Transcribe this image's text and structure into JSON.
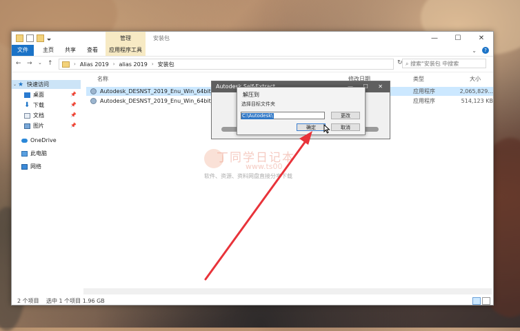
{
  "explorer": {
    "manage_tab": "管理",
    "title": "安装包",
    "window_controls": [
      "—",
      "☐",
      "✕"
    ],
    "ribbon_tabs": {
      "file": "文件",
      "home": "主页",
      "share": "共享",
      "view": "查看",
      "app_tools": "应用程序工具"
    },
    "help_icon": "?",
    "nav_icons": {
      "back": "←",
      "forward": "→",
      "dropdown": "⌄",
      "up": "↑",
      "refresh": "↻"
    },
    "breadcrumb": [
      "Alias 2019",
      "alias 2019",
      "安装包"
    ],
    "search_placeholder": "搜索\"安装包 中搜索",
    "sidebar": {
      "quick_access": "快速访问",
      "desktop": "桌面",
      "downloads": "下载",
      "documents": "文档",
      "pictures": "图片",
      "onedrive": "OneDrive",
      "this_pc": "此电脑",
      "network": "网络"
    },
    "columns": {
      "name": "名称",
      "date": "修改日期",
      "type": "类型",
      "size": "大小"
    },
    "files": [
      {
        "name": "Autodesk_DESNST_2019_Enu_Win_64bit_dlm_00",
        "type": "应用程序",
        "size": "2,065,829..."
      },
      {
        "name": "Autodesk_DESNST_2019_Enu_Win_64bit_dlm_00",
        "type": "应用程序",
        "size": "514,123 KB"
      }
    ],
    "status": {
      "count": "2 个项目",
      "selected": "选中 1 个项目  1.96 GB"
    }
  },
  "self_extract": {
    "title": "Autodesk Self-Extract",
    "controls": "— ☐ ✕"
  },
  "unzip_dialog": {
    "title": "解压到",
    "label": "选择目标文件夹",
    "path_value": "C:\\Autodesk\\",
    "change_button": "更改",
    "ok_button": "确定",
    "cancel_button": "取消"
  },
  "watermark": {
    "line1": "丁同学日记本",
    "line2": "www.ts00",
    "line3": "软件、资源、资料网盘直接分享下载"
  },
  "colors": {
    "accent": "#1b73c7",
    "arrow": "#e8333a",
    "selection": "#cce8ff"
  }
}
